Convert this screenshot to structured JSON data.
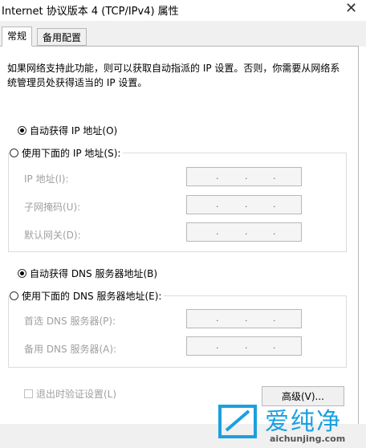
{
  "window": {
    "title": "Internet 协议版本 4 (TCP/IPv4) 属性",
    "close_glyph": "✕"
  },
  "tabs": [
    {
      "label": "常规",
      "active": true
    },
    {
      "label": "备用配置",
      "active": false
    }
  ],
  "description": "如果网络支持此功能，则可以获取自动指派的 IP 设置。否则，你需要从网络系统管理员处获得适当的 IP 设置。",
  "ip": {
    "auto_label": "自动获得 IP 地址(O)",
    "auto_checked": true,
    "manual_label": "使用下面的 IP 地址(S):",
    "fields": [
      {
        "label": "IP 地址(I):",
        "value": ". . ."
      },
      {
        "label": "子网掩码(U):",
        "value": ". . ."
      },
      {
        "label": "默认网关(D):",
        "value": ". . ."
      }
    ]
  },
  "dns": {
    "auto_label": "自动获得 DNS 服务器地址(B)",
    "auto_checked": true,
    "manual_label": "使用下面的 DNS 服务器地址(E):",
    "fields": [
      {
        "label": "首选 DNS 服务器(P):",
        "value": ". . ."
      },
      {
        "label": "备用 DNS 服务器(A):",
        "value": ". . ."
      }
    ]
  },
  "validate_label": "退出时验证设置(L)",
  "validate_checked": false,
  "advanced_button": "高级(V)...",
  "watermark": {
    "name": "爱纯净",
    "url": "aichunjing.com"
  }
}
